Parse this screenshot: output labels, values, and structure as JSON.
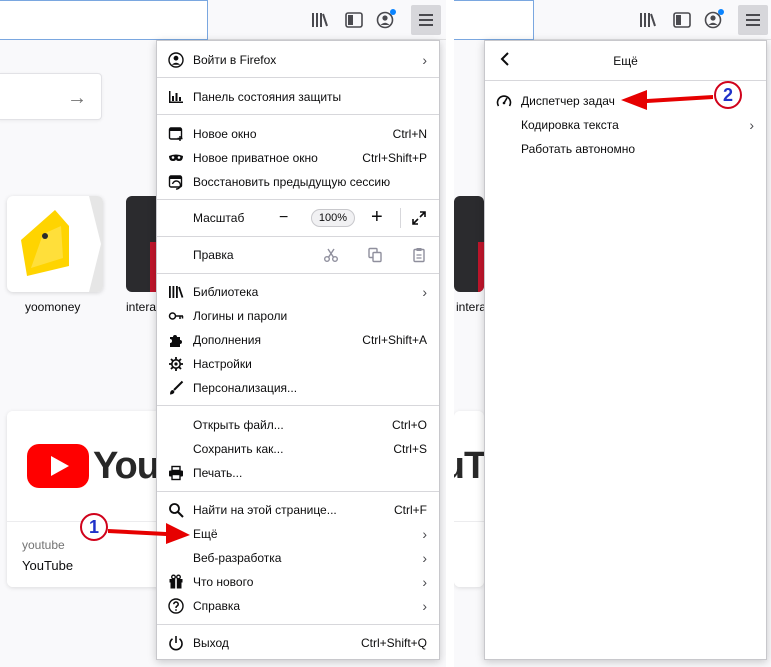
{
  "colors": {
    "accent": "#0a84ff",
    "annotation_red": "#e60000",
    "annotation_number": "#1f31c9",
    "youtube_red": "#ff0000"
  },
  "left": {
    "tiles": [
      {
        "label": "yoomoney",
        "icon": "yoomoney-logo"
      },
      {
        "label": "intera"
      }
    ],
    "highlight_card": {
      "site": "youtube",
      "title": "YouTube",
      "logo_text": "YouTube"
    }
  },
  "main_menu": {
    "sign_in": "Войти в Firefox",
    "protection": "Панель состояния защиты",
    "new_window": {
      "label": "Новое окно",
      "shortcut": "Ctrl+N"
    },
    "private_window": {
      "label": "Новое приватное окно",
      "shortcut": "Ctrl+Shift+P"
    },
    "restore": "Восстановить предыдущую сессию",
    "zoom": {
      "label": "Масштаб",
      "minus": "−",
      "value": "100%",
      "plus": "+"
    },
    "edit": {
      "label": "Правка"
    },
    "library": "Библиотека",
    "logins": "Логины и пароли",
    "addons": {
      "label": "Дополнения",
      "shortcut": "Ctrl+Shift+A"
    },
    "settings": "Настройки",
    "customize": "Персонализация...",
    "open_file": {
      "label": "Открыть файл...",
      "shortcut": "Ctrl+O"
    },
    "save_as": {
      "label": "Сохранить как...",
      "shortcut": "Ctrl+S"
    },
    "print": "Печать...",
    "find": {
      "label": "Найти на этой странице...",
      "shortcut": "Ctrl+F"
    },
    "more": "Ещё",
    "web_dev": "Веб-разработка",
    "whats_new": "Что нового",
    "help": "Справка",
    "exit": {
      "label": "Выход",
      "shortcut": "Ctrl+Shift+Q"
    }
  },
  "more_menu": {
    "title": "Ещё",
    "task_manager": "Диспетчер задач",
    "encoding": "Кодировка текста",
    "offline": "Работать автономно"
  },
  "annotations": {
    "step1": "1",
    "step2": "2"
  }
}
